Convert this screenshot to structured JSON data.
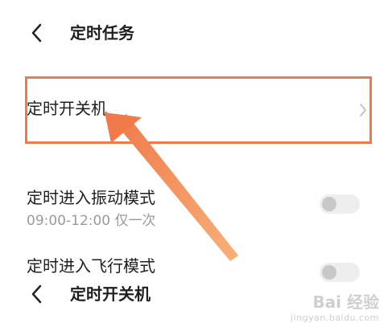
{
  "header": {
    "title": "定时任务",
    "back_icon": "back-arrow-icon"
  },
  "items": [
    {
      "label": "定时开关机",
      "has_chevron": true
    },
    {
      "label": "定时进入振动模式",
      "detail": "09:00-12:00 仅一次",
      "toggle_on": false
    },
    {
      "label": "定时进入飞行模式",
      "toggle_on": false
    }
  ],
  "footer": {
    "title": "定时开关机",
    "back_icon": "back-arrow-icon"
  },
  "watermark": {
    "brand": "Bai 经验",
    "url": "jingyan.baidu.com"
  },
  "colors": {
    "highlight": "#f07a4a",
    "arrow": "#f4a06b"
  }
}
